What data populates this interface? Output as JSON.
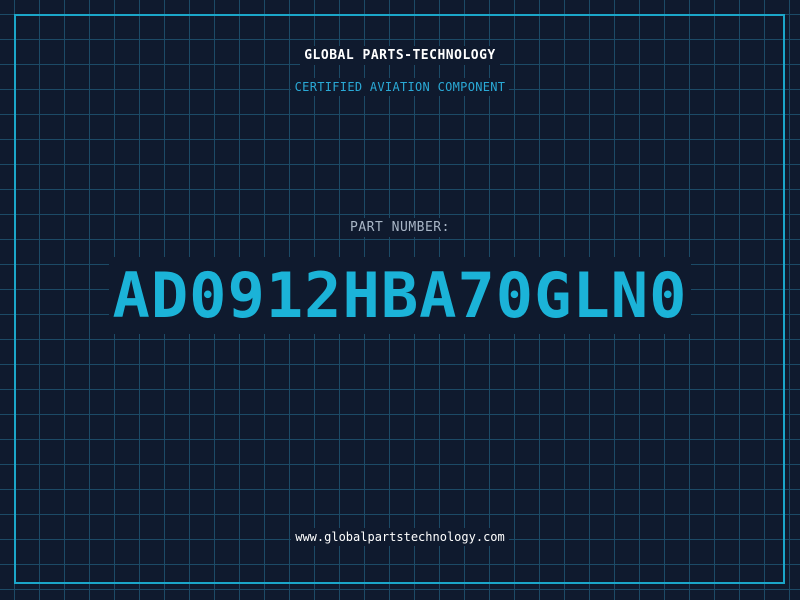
{
  "header": {
    "brand": "GLOBAL PARTS-TECHNOLOGY",
    "tagline": "CERTIFIED AVIATION COMPONENT"
  },
  "part": {
    "label": "PART NUMBER:",
    "number": "AD0912HBA70GLN0"
  },
  "footer": {
    "website": "www.globalpartstechnology.com"
  },
  "colors": {
    "background": "#0f1a2e",
    "grid": "#1c4a66",
    "accent": "#1bb3d8",
    "text": "#ffffff"
  }
}
